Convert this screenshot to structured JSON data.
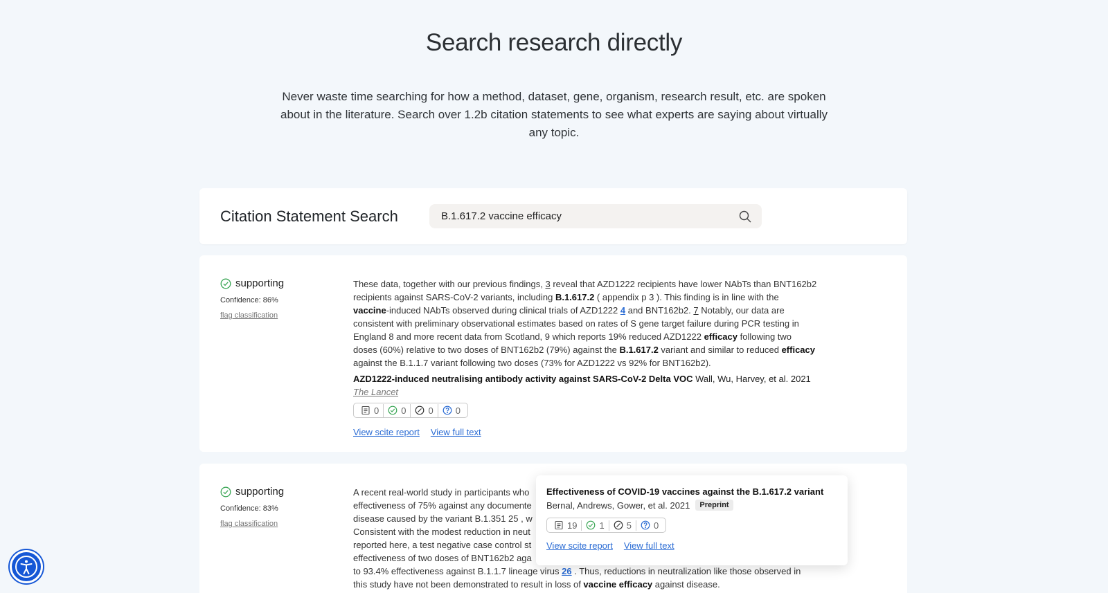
{
  "hero": {
    "title": "Search research directly",
    "description": "Never waste time searching for how a method, dataset, gene, organism, research result, etc. are spoken about in the literature. Search over 1.2b citation statements to see what experts are saying about virtually any topic."
  },
  "search": {
    "title": "Citation Statement Search",
    "value": "B.1.617.2 vaccine efficacy"
  },
  "results": [
    {
      "label": "supporting",
      "confidence": "Confidence: 86%",
      "flag": "flag classification",
      "text": {
        "s1": "These data, together with our previous findings, ",
        "s1ref": "3",
        "s2": " reveal that AZD1222 recipients have lower NAbTs than BNT162b2 recipients against SARS-CoV-2 variants, including ",
        "b1": "B.1.617.2",
        "s3": " ( appendix p 3 ). This finding is in line with the ",
        "b2": "vaccine",
        "s4": "-induced NAbTs observed during clinical trials of AZD1222 ",
        "ref1": "4",
        "s5": " and BNT162b2. ",
        "s5ref": "7",
        "s6": " Notably, our data are consistent with preliminary observational estimates based on rates of S gene target failure during PCR testing in England 8 and more recent data from Scotland, 9 which reports 19% reduced AZD1222 ",
        "b3": "efficacy",
        "s7": " following two doses (60%) relative to two doses of BNT162b2 (79%) against the ",
        "b4": "B.1.617.2",
        "s8": " variant and similar to reduced ",
        "b5": "efficacy",
        "s9": " against the B.1.1.7 variant following two doses (73% for AZD1222 vs 92% for BNT162b2)."
      },
      "paper_title": "AZD1222-induced neutralising antibody activity against SARS-CoV-2 Delta VOC",
      "authors": "Wall, Wu, Harvey, et al. 2021",
      "journal": "The Lancet",
      "metrics": {
        "publications": "0",
        "supporting": "0",
        "contrasting": "0",
        "mentioning": "0"
      },
      "links": {
        "report": "View scite report",
        "fulltext": "View full text"
      }
    },
    {
      "label": "supporting",
      "confidence": "Confidence: 83%",
      "flag": "flag classification",
      "lines": [
        "A recent real-world study in participants who",
        "effectiveness of 75% against any documente",
        "disease caused by the variant B.1.351 25 , w",
        "Consistent with the modest reduction in neut",
        "reported here, a test negative case control st",
        "effectiveness of two doses of BNT162b2 aga"
      ],
      "last_pre": "to 93.4% effectiveness against B.1.1.7 lineage virus ",
      "last_ref": "26",
      "last_post": " . Thus, reductions in neutralization like those observed in",
      "final_pre": "this study have not been demonstrated to result in loss of ",
      "final_bold": "vaccine efficacy",
      "final_post": " against disease."
    }
  ],
  "tooltip": {
    "title": "Effectiveness of COVID-19 vaccines against the B.1.617.2 variant",
    "authors": "Bernal, Andrews, Gower, et al. 2021",
    "badge": "Preprint",
    "metrics": {
      "publications": "19",
      "supporting": "1",
      "contrasting": "5",
      "mentioning": "0"
    },
    "links": {
      "report": "View scite report",
      "fulltext": "View full text"
    }
  },
  "colors": {
    "supporting": "#3aa655",
    "link": "#2b6cd4",
    "contrasting": "#333333",
    "mentioning": "#2b6cd4",
    "accessibility": "#1557d6"
  },
  "icons": [
    "search-icon",
    "check-circle-icon",
    "document-icon",
    "slash-circle-icon",
    "question-circle-icon",
    "accessibility-icon"
  ]
}
